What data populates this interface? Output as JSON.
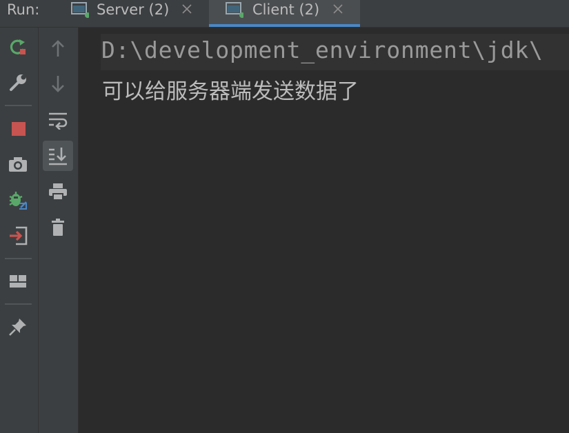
{
  "run_panel": {
    "label": "Run:",
    "tabs": [
      {
        "label": "Server (2)",
        "active": false
      },
      {
        "label": "Client (2)",
        "active": true
      }
    ]
  },
  "toolbar_left": [
    {
      "icon": "rerun-icon"
    },
    {
      "icon": "wrench-icon"
    },
    {
      "icon": "stop-icon"
    },
    {
      "icon": "camera-icon"
    },
    {
      "icon": "debug-icon"
    },
    {
      "icon": "exit-icon"
    },
    {
      "icon": "layout-icon"
    },
    {
      "icon": "pin-icon"
    }
  ],
  "toolbar_right": [
    {
      "icon": "arrow-up-icon"
    },
    {
      "icon": "arrow-down-icon"
    },
    {
      "icon": "soft-wrap-icon"
    },
    {
      "icon": "scroll-to-end-icon"
    },
    {
      "icon": "print-icon"
    },
    {
      "icon": "trash-icon"
    }
  ],
  "console": {
    "command_line": "D:\\development_environment\\jdk\\",
    "output_line": "可以给服务器端发送数据了"
  },
  "colors": {
    "accent": "#4a88c7",
    "run_green": "#59a869",
    "stop_red": "#c75450",
    "exit_red": "#c75450",
    "background": "#2b2b2b",
    "panel": "#3c3f41"
  }
}
